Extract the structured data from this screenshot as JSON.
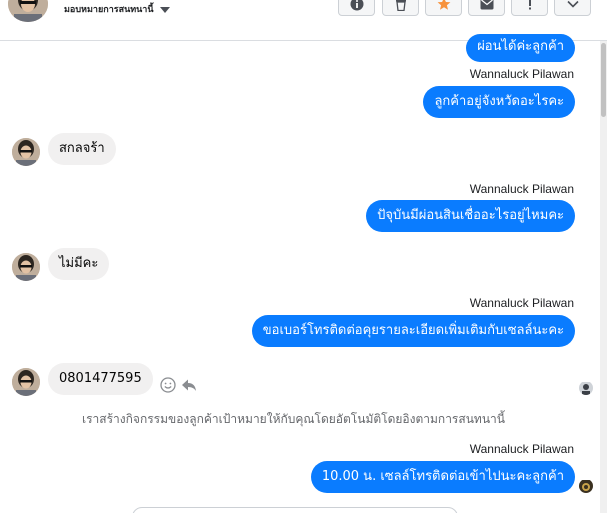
{
  "header": {
    "assign_label": "มอบหมายการสนทนานี้",
    "buttons": [
      {
        "name": "info-button",
        "icon": "info-icon"
      },
      {
        "name": "delete-button",
        "icon": "trash-icon"
      },
      {
        "name": "star-button",
        "icon": "star-icon",
        "color": "#f7923b"
      },
      {
        "name": "email-button",
        "icon": "envelope-icon"
      },
      {
        "name": "flag-button",
        "icon": "exclamation-icon"
      },
      {
        "name": "done-button",
        "icon": "check-icon"
      }
    ]
  },
  "colors": {
    "outgoing_bubble": "#0a7cff",
    "incoming_bubble": "#f1f0f0",
    "star": "#f7923b"
  },
  "messages": [
    {
      "direction": "out",
      "text": "ผ่อนได้ค่ะลูกค้า"
    },
    {
      "direction": "out",
      "sender": "Wannaluck Pilawan",
      "text": "ลูกค้าอยู่จังหวัดอะไรคะ"
    },
    {
      "direction": "in",
      "text": "สกลจร้า"
    },
    {
      "direction": "out",
      "sender": "Wannaluck Pilawan",
      "text": "ปัจุบันมีผ่อนสินเชื่ออะไรอยู่ไหมคะ"
    },
    {
      "direction": "in",
      "text": "ไม่มีคะ"
    },
    {
      "direction": "out",
      "sender": "Wannaluck Pilawan",
      "text": "ขอเบอร์โทรติดต่อคุยรายละเอียดเพิ่มเติมกับเซลล์นะคะ"
    },
    {
      "direction": "in",
      "text": "0801477595"
    },
    {
      "direction": "out",
      "sender": "Wannaluck Pilawan",
      "text": "10.00 น. เซลล์โทรติดต่อเข้าไปนะคะลูกค้า"
    }
  ],
  "system_note": "เราสร้างกิจกรรมของลูกค้าเป้าหมายให้กับคุณโดยอัตโนมัติโดยอิงตามการสนทนานี้"
}
